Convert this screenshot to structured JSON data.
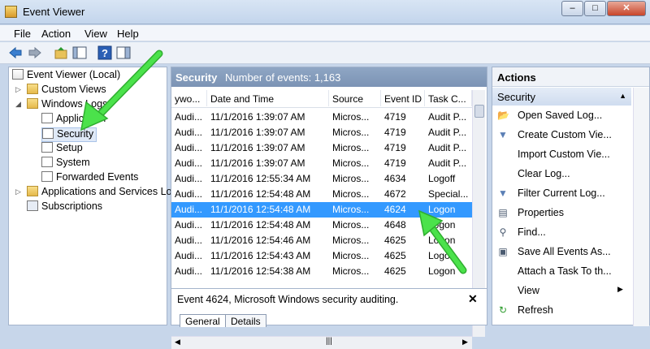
{
  "window": {
    "title": "Event Viewer",
    "icon": "event-viewer-icon",
    "min": "–",
    "max": "□",
    "close": "✕"
  },
  "menu": [
    "File",
    "Action",
    "View",
    "Help"
  ],
  "toolbar": [
    "back-arrow-icon",
    "forward-arrow-icon",
    "up-folder-icon",
    "show-hide-tree-icon",
    "help-icon",
    "show-hide-action-pane-icon"
  ],
  "tree": {
    "root": "Event Viewer (Local)",
    "custom_views": "Custom Views",
    "windows_logs": "Windows Logs",
    "application": "Application",
    "security": "Security",
    "setup": "Setup",
    "system": "System",
    "forwarded": "Forwarded Events",
    "apps_services": "Applications and Services Logs",
    "subscriptions": "Subscriptions"
  },
  "center": {
    "log_name": "Security",
    "event_count": "Number of events: 1,163",
    "columns": [
      "ywo...",
      "Date and Time",
      "Source",
      "Event ID",
      "Task C..."
    ],
    "rows": [
      [
        "Audi...",
        "11/1/2016 1:39:07 AM",
        "Micros...",
        "4719",
        "Audit P..."
      ],
      [
        "Audi...",
        "11/1/2016 1:39:07 AM",
        "Micros...",
        "4719",
        "Audit P..."
      ],
      [
        "Audi...",
        "11/1/2016 1:39:07 AM",
        "Micros...",
        "4719",
        "Audit P..."
      ],
      [
        "Audi...",
        "11/1/2016 1:39:07 AM",
        "Micros...",
        "4719",
        "Audit P..."
      ],
      [
        "Audi...",
        "11/1/2016 12:55:34 AM",
        "Micros...",
        "4634",
        "Logoff"
      ],
      [
        "Audi...",
        "11/1/2016 12:54:48 AM",
        "Micros...",
        "4672",
        "Special..."
      ],
      [
        "Audi...",
        "11/1/2016 12:54:48 AM",
        "Micros...",
        "4624",
        "Logon"
      ],
      [
        "Audi...",
        "11/1/2016 12:54:48 AM",
        "Micros...",
        "4648",
        "Logon"
      ],
      [
        "Audi...",
        "11/1/2016 12:54:46 AM",
        "Micros...",
        "4625",
        "Logon"
      ],
      [
        "Audi...",
        "11/1/2016 12:54:43 AM",
        "Micros...",
        "4625",
        "Logon"
      ],
      [
        "Audi...",
        "11/1/2016 12:54:38 AM",
        "Micros...",
        "4625",
        "Logon"
      ]
    ],
    "selected_row": 6
  },
  "details": {
    "title": "Event 4624, Microsoft Windows security auditing.",
    "close": "✕",
    "tab_general": "General",
    "tab_details": "Details"
  },
  "actions": {
    "header": "Actions",
    "section": "Security",
    "items": [
      {
        "label": "Open Saved Log...",
        "icon": "open-log-icon"
      },
      {
        "label": "Create Custom Vie...",
        "icon": "filter-create-icon"
      },
      {
        "label": "Import Custom Vie...",
        "icon": ""
      },
      {
        "label": "Clear Log...",
        "icon": ""
      },
      {
        "label": "Filter Current Log...",
        "icon": "filter-icon"
      },
      {
        "label": "Properties",
        "icon": "properties-icon"
      },
      {
        "label": "Find...",
        "icon": "find-icon"
      },
      {
        "label": "Save All Events As...",
        "icon": "save-icon"
      },
      {
        "label": "Attach a Task To th...",
        "icon": ""
      },
      {
        "label": "View",
        "icon": ""
      },
      {
        "label": "Refresh",
        "icon": "refresh-icon"
      }
    ]
  },
  "colors": {
    "selection": "#3399ff",
    "annotation_arrow": "#3cd23c"
  }
}
